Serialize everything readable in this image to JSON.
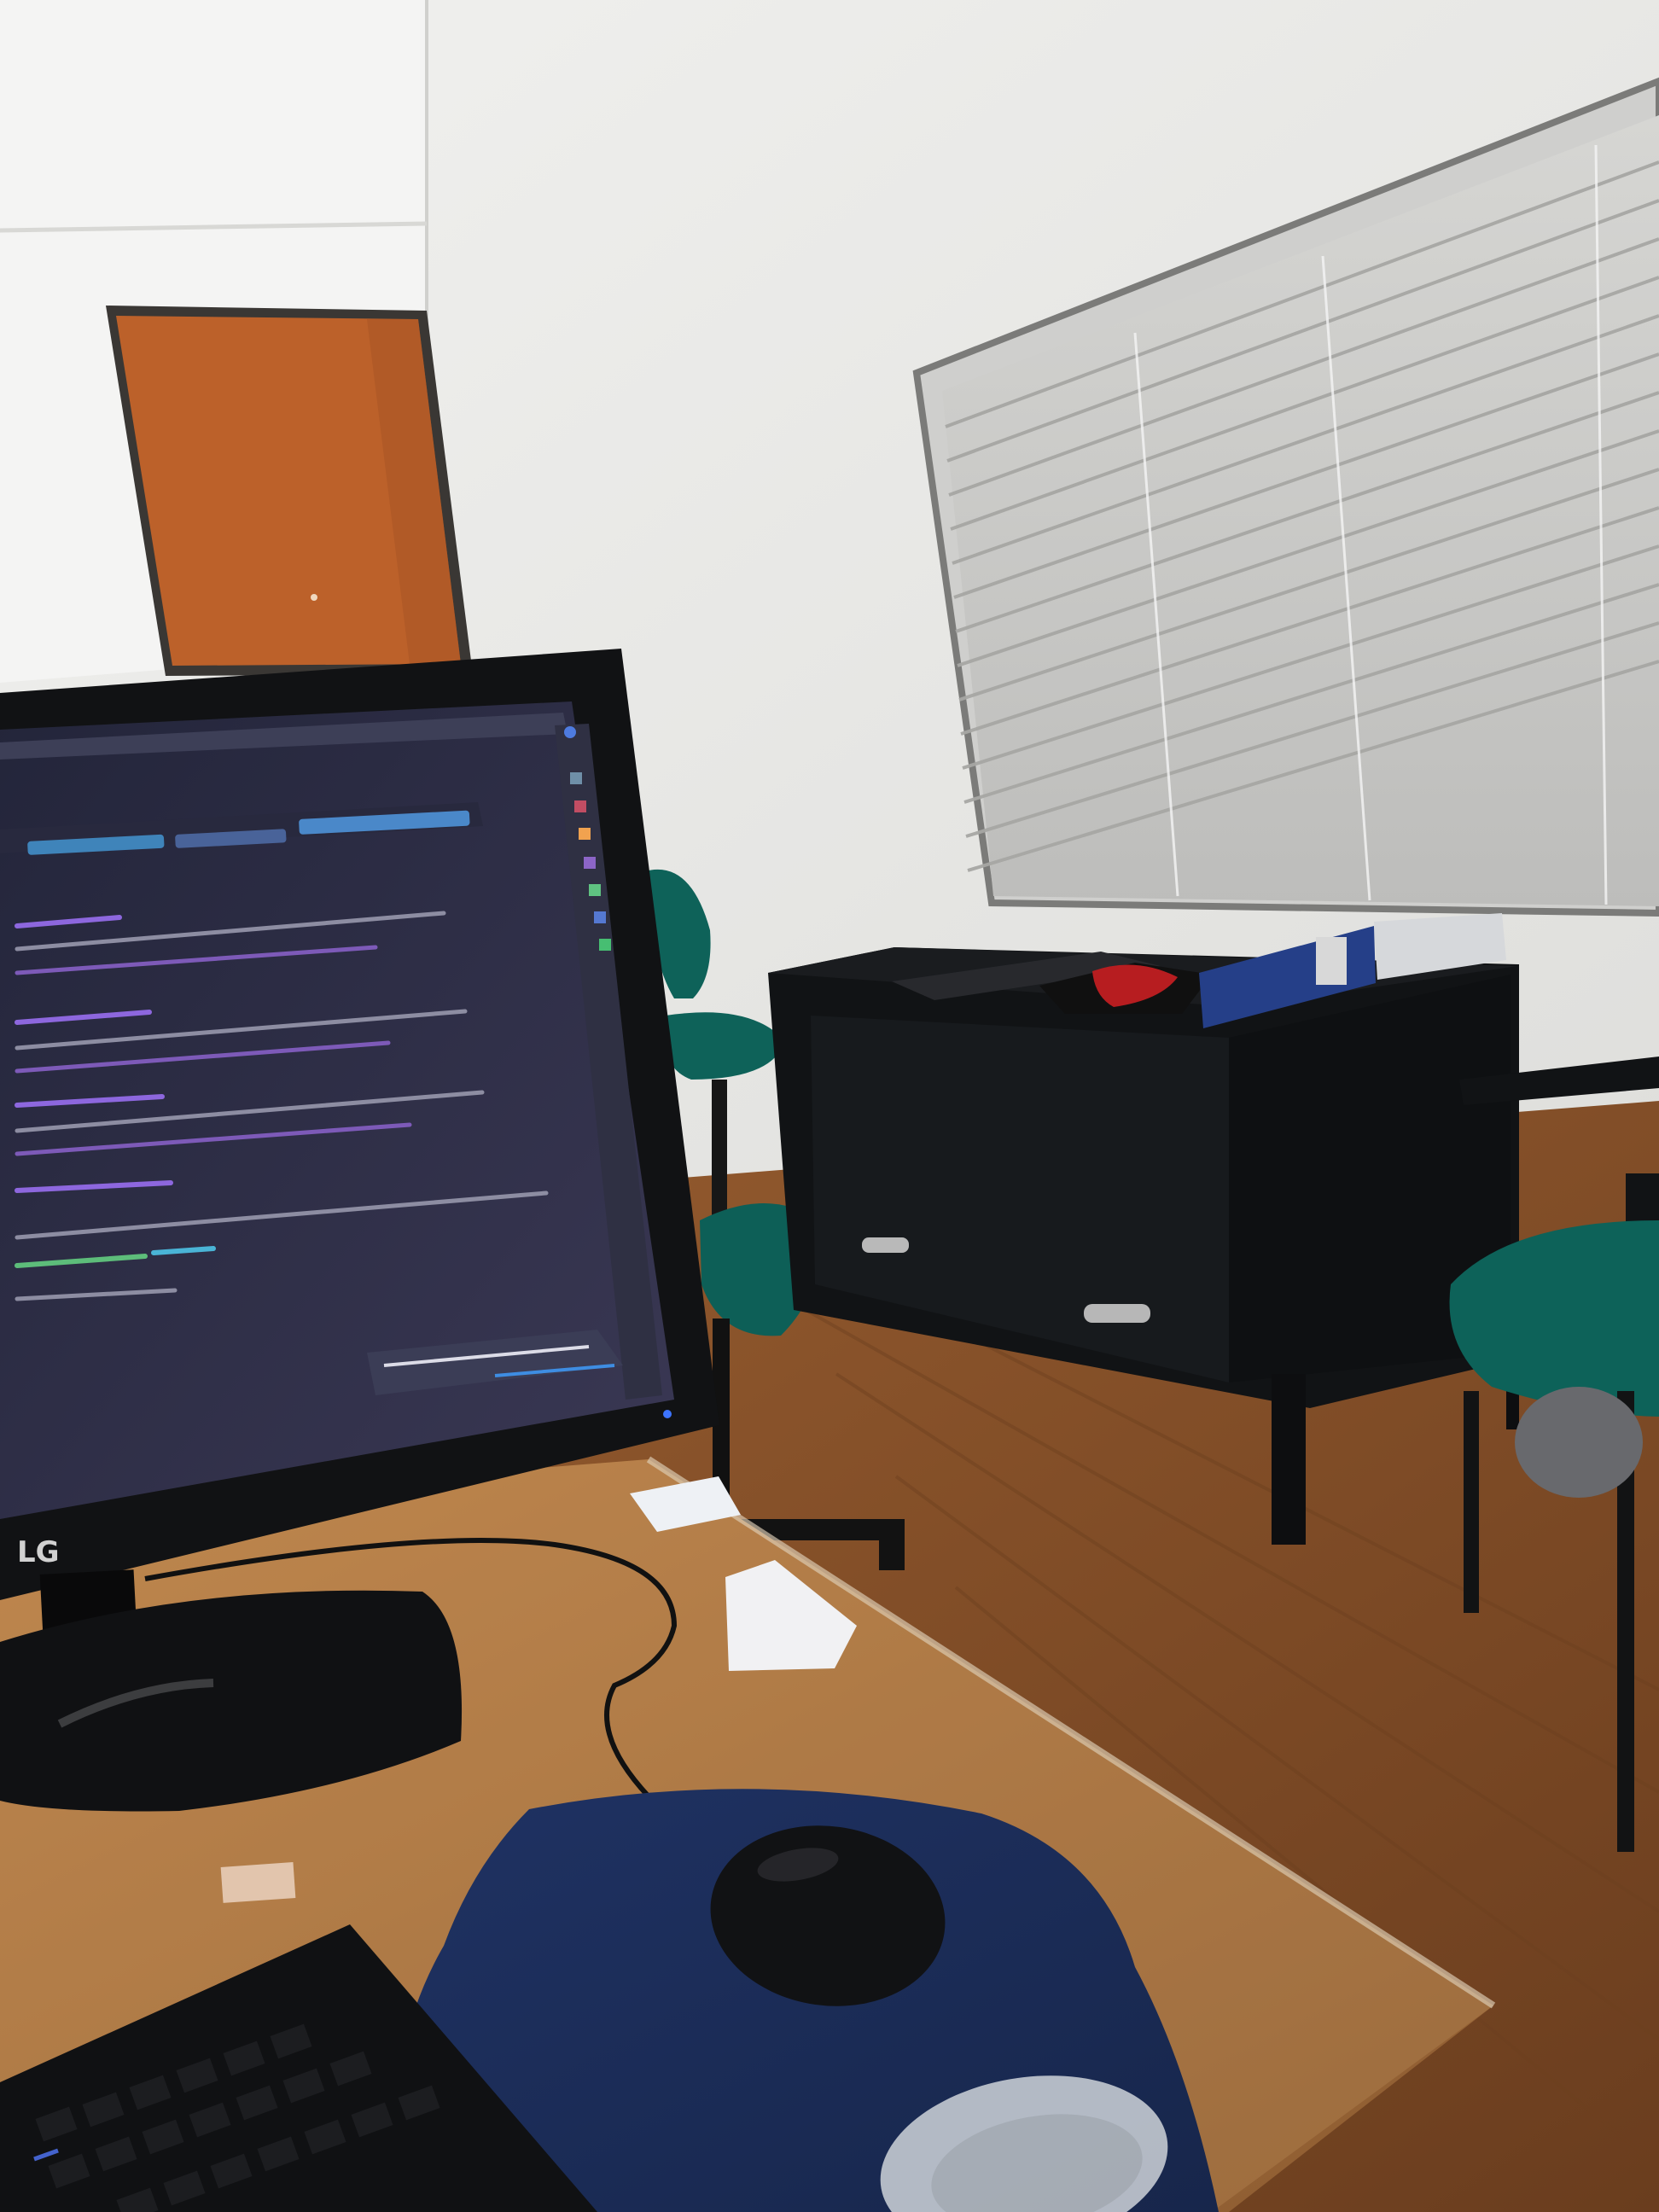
{
  "scene": {
    "monitor": {
      "brand_logo": "LG"
    },
    "colors": {
      "wall": "#ecece9",
      "wall_shadow": "#dcdcd8",
      "door": "#b85f28",
      "door_frame": "#3a3734",
      "floor": "#8a522b",
      "floor_dark": "#5b3418",
      "desk": "#a8713e",
      "desk_glass": "#c99a66",
      "cabinet": "#121314",
      "chair_seat": "#0c5f57",
      "chair_frame": "#15171a",
      "mouse_pad": "#203160",
      "mouse": "#111214",
      "keyboard": "#101113",
      "blinds": "#c9c9c7",
      "screen_bg": "#2c2b3f",
      "screen_panel": "#34324a",
      "code_purple": "#9d6ce3",
      "code_cyan": "#4ab4d6",
      "code_green": "#5dbd7a",
      "code_gray": "#8c8ca1",
      "binder": "#253f88"
    }
  }
}
